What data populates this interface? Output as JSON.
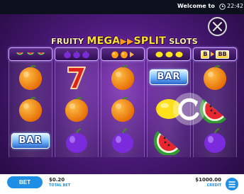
{
  "status_bar": {
    "welcome_text": "Welcome to Fru",
    "time": "22:42"
  },
  "logo": {
    "part_fruity": "FRUITY",
    "part_mega": "MEGA",
    "part_arrows": "▶▶",
    "part_split": "SPLIT",
    "part_slots": "SLOTS"
  },
  "symbol_strip": {
    "bb_label": "B",
    "bb_label_double": "BB"
  },
  "reels": [
    {
      "symbols": [
        "orange-icon",
        "orange-icon",
        "bar"
      ]
    },
    {
      "symbols": [
        "seven-icon",
        "orange-icon",
        "plum-icon"
      ]
    },
    {
      "symbols": [
        "orange-icon",
        "orange-icon",
        "plum-icon"
      ]
    },
    {
      "symbols": [
        "bar",
        "lemon-icon",
        "watermelon-icon"
      ]
    },
    {
      "symbols": [
        "orange-icon",
        "watermelon-icon",
        "plum-icon"
      ]
    }
  ],
  "symbols": {
    "bar_label": "BAR",
    "seven_label": "7"
  },
  "bottom_bar": {
    "bet_button_label": "BET",
    "total_bet_value": "$0.20",
    "total_bet_label": "TOTAL BET",
    "credit_value": "$1000.00",
    "credit_label": "CREDIT"
  },
  "colors": {
    "accent_blue": "#1f8fe6",
    "background_purple": "#4a1a78",
    "status_bar": "#0c0f1c"
  }
}
